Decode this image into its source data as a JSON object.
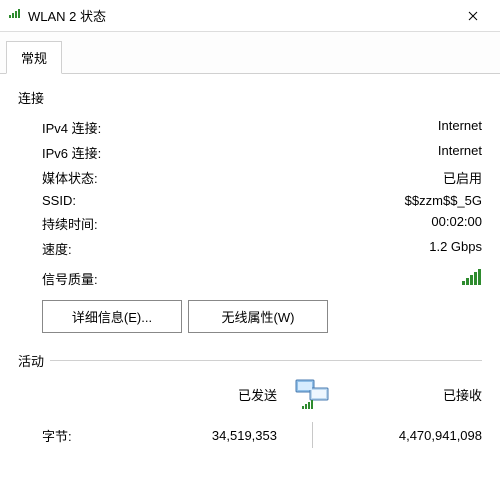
{
  "title": "WLAN 2 状态",
  "tab_general": "常规",
  "section_connection": "连接",
  "section_activity": "活动",
  "rows": {
    "ipv4_k": "IPv4 连接:",
    "ipv4_v": "Internet",
    "ipv6_k": "IPv6 连接:",
    "ipv6_v": "Internet",
    "media_k": "媒体状态:",
    "media_v": "已启用",
    "ssid_k": "SSID:",
    "ssid_v": "$$zzm$$_5G",
    "duration_k": "持续时间:",
    "duration_v": "00:02:00",
    "speed_k": "速度:",
    "speed_v": "1.2 Gbps",
    "signal_k": "信号质量:"
  },
  "buttons": {
    "details": "详细信息(E)...",
    "wireless": "无线属性(W)"
  },
  "activity": {
    "sent": "已发送",
    "received": "已接收",
    "bytes_label": "字节:",
    "sent_bytes": "34,519,353",
    "recv_bytes": "4,470,941,098"
  }
}
